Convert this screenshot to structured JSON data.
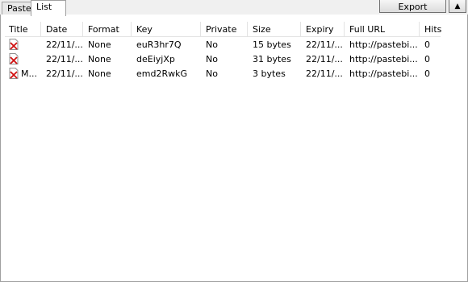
{
  "tabs": [
    {
      "label": "Paste",
      "active": false
    },
    {
      "label": "List",
      "active": true
    }
  ],
  "toolbar": {
    "export_label": "Export",
    "collapse_glyph": "▲"
  },
  "table": {
    "columns": [
      "Title",
      "Date",
      "Format",
      "Key",
      "Private",
      "Size",
      "Expiry",
      "Full URL",
      "Hits"
    ],
    "rows": [
      {
        "title": "",
        "date": "22/11/...",
        "format": "None",
        "key": "euR3hr7Q",
        "private": "No",
        "size": "15 bytes",
        "expiry": "22/11/...",
        "url": "http://pastebi...",
        "hits": "0"
      },
      {
        "title": "",
        "date": "22/11/...",
        "format": "None",
        "key": "deEiyjXp",
        "private": "No",
        "size": "31 bytes",
        "expiry": "22/11/...",
        "url": "http://pastebi...",
        "hits": "0"
      },
      {
        "title": "M...",
        "date": "22/11/...",
        "format": "None",
        "key": "emd2RwkG",
        "private": "No",
        "size": "3 bytes",
        "expiry": "22/11/...",
        "url": "http://pastebi...",
        "hits": "0"
      }
    ],
    "row_icon": "document-error-icon"
  },
  "colors": {
    "icon_red": "#d01010",
    "border": "#a0a0a0",
    "grid": "#e3e3e3"
  }
}
